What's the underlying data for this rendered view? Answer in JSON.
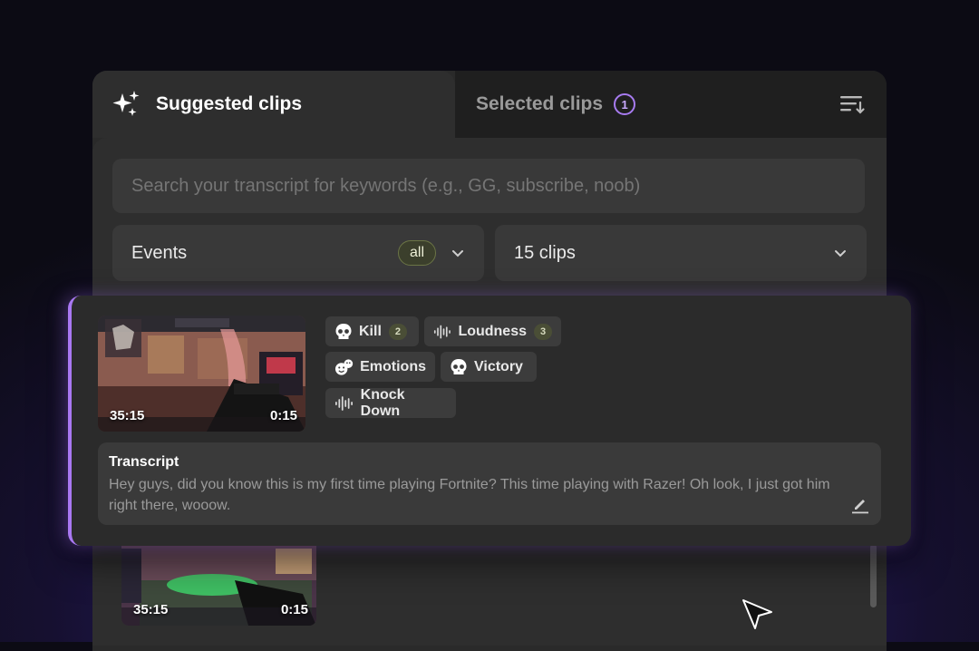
{
  "tabs": {
    "suggested": "Suggested clips",
    "selected": "Selected clips",
    "selected_count": "1"
  },
  "search": {
    "placeholder": "Search your transcript for keywords (e.g., GG, subscribe, noob)"
  },
  "filters": {
    "events_label": "Events",
    "events_badge": "all",
    "clips_label": "15 clips"
  },
  "clip": {
    "start_time": "35:15",
    "duration": "0:15",
    "tags": [
      {
        "label": "Kill",
        "count": "2",
        "icon": "skull-icon"
      },
      {
        "label": "Loudness",
        "count": "3",
        "icon": "soundwave-icon"
      },
      {
        "label": "Emotions",
        "icon": "emotions-icon"
      },
      {
        "label": "Victory",
        "icon": "skull-icon"
      },
      {
        "label": "Knock Down",
        "icon": "soundwave-icon"
      }
    ],
    "transcript_title": "Transcript",
    "transcript_text": "Hey guys, did you know this is my first time playing Fortnite? This time playing with Razer! Oh look, I just got him right there, wooow."
  },
  "clip2": {
    "start_time": "35:15",
    "duration": "0:15"
  },
  "colors": {
    "accent": "#a978f2",
    "badge": "#4a4e36"
  }
}
